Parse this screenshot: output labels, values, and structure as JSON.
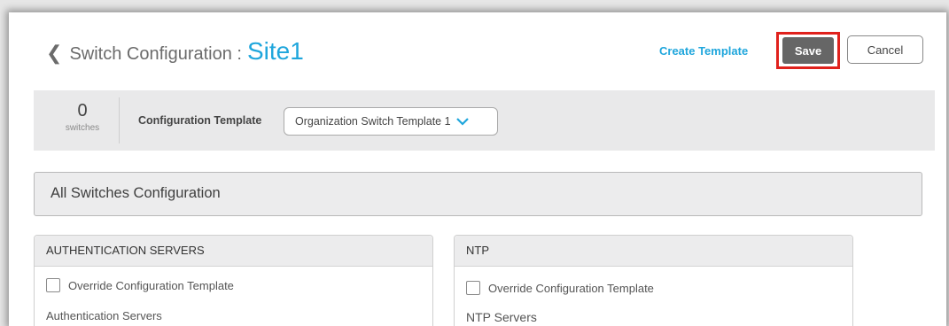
{
  "header": {
    "title": "Switch Configuration :",
    "site": "Site1",
    "create_template": "Create Template",
    "save": "Save",
    "cancel": "Cancel"
  },
  "toolbar": {
    "switch_count": "0",
    "switch_label": "switches",
    "config_template_label": "Configuration Template",
    "config_template_value": "Organization Switch Template 1"
  },
  "section": {
    "title": "All Switches Configuration"
  },
  "panels": {
    "auth": {
      "title": "AUTHENTICATION SERVERS",
      "override_label": "Override Configuration Template",
      "sub_label": "Authentication Servers"
    },
    "ntp": {
      "title": "NTP",
      "override_label": "Override Configuration Template",
      "sub_label": "NTP Servers"
    }
  },
  "colors": {
    "accent": "#1fa6dc",
    "highlight": "#e0211c",
    "save_button": "#666666"
  }
}
